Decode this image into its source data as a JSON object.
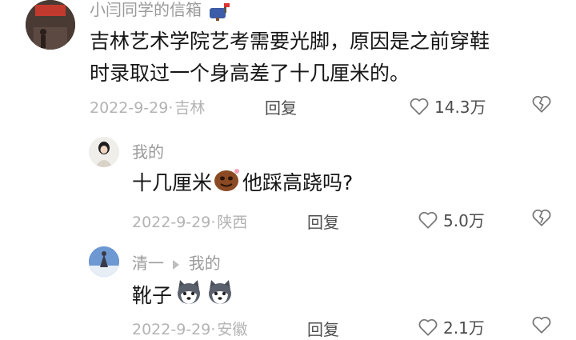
{
  "comments": [
    {
      "user": "小闫同学的信箱",
      "text_line1": "吉林艺术学院艺考需要光脚，原因是之前穿鞋",
      "text_line2": "时录取过一个身高差了十几厘米的。",
      "date": "2022-9-29",
      "sep": "·",
      "location": "吉林",
      "reply_label": "回复",
      "likes": "14.3万"
    },
    {
      "user": "我的",
      "text_before": "十几厘米",
      "text_after": "他踩高跷吗?",
      "date": "2022-9-29",
      "sep": "·",
      "location": "陕西",
      "reply_label": "回复",
      "likes": "5.0万"
    },
    {
      "user": "清一",
      "reply_to": "我的",
      "text": "靴子",
      "date": "2022-9-29",
      "sep": "·",
      "location": "安徽",
      "reply_label": "回复",
      "likes": "2.1万"
    }
  ],
  "colors": {
    "meta": "#b3b3b3",
    "text": "#161616",
    "name": "#9a9a9a"
  },
  "icons": [
    "mailbox-icon",
    "heart-icon",
    "dislike-icon",
    "smiley-emoji-icon",
    "husky-emoji-icon"
  ]
}
